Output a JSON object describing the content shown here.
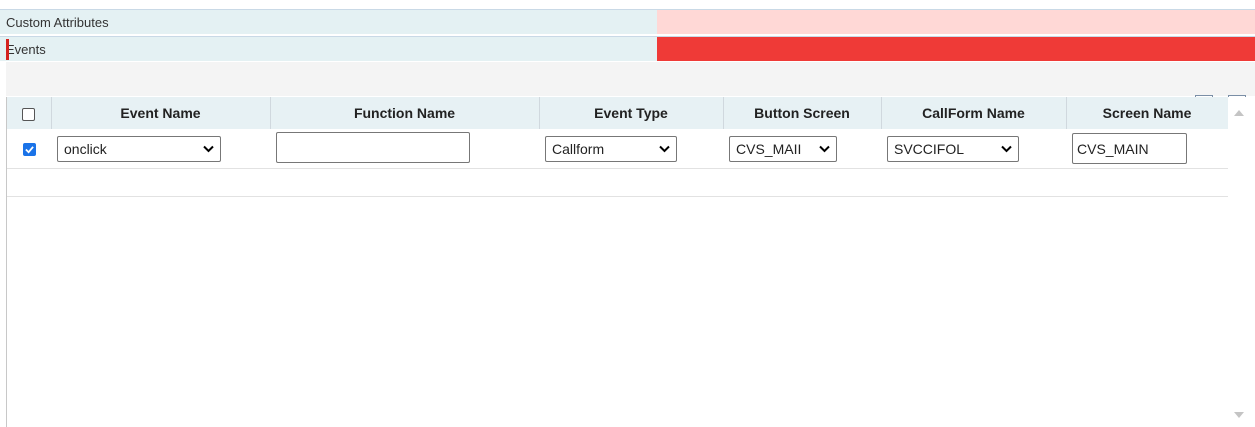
{
  "sections": {
    "custom_attributes": "Custom Attributes",
    "events": "Events"
  },
  "toolbar": {
    "add_icon": "plus-icon",
    "remove_icon": "minus-icon",
    "add_color": "#1a5fb4",
    "remove_color": "#d32f2f"
  },
  "grid": {
    "columns": [
      "Event Name",
      "Function Name",
      "Event Type",
      "Button Screen",
      "CallForm Name",
      "Screen Name"
    ],
    "rows": [
      {
        "checked": true,
        "event_name": "onclick",
        "function_name": "",
        "event_type": "Callform",
        "button_screen": "CVS_MAII",
        "callform_name": "SVCCIFOL",
        "screen_name": "CVS_MAIN"
      }
    ]
  },
  "colors": {
    "header_bg": "#e7f1f4",
    "events_fill": "#ef3a37",
    "custom_fill": "#ffd8d6",
    "checkbox_accent": "#1a73e8"
  }
}
